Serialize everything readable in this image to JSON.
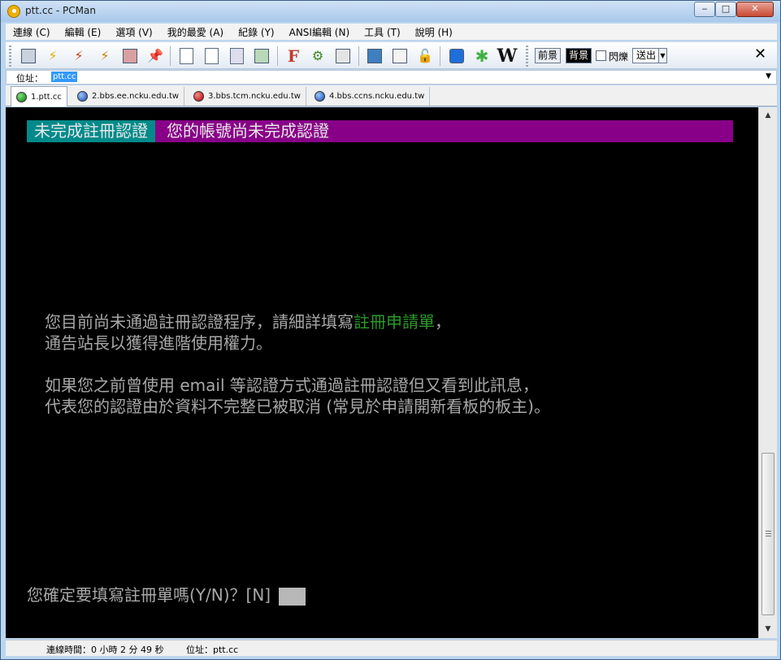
{
  "window": {
    "title": "ptt.cc - PCMan"
  },
  "menu": [
    "連線 (C)",
    "編輯 (E)",
    "選項 (V)",
    "我的最愛 (A)",
    "紀錄 (Y)",
    "ANSI編輯 (N)",
    "工具 (T)",
    "說明 (H)"
  ],
  "toolbar": {
    "fg_label": "前景",
    "bg_label": "背景",
    "blink_label": "閃爍",
    "send_label": "送出"
  },
  "address": {
    "label": "位址：",
    "value": "ptt.cc"
  },
  "tabs": [
    {
      "label": "1.ptt.cc",
      "color": "#0a7a0a"
    },
    {
      "label": "2.bbs.ee.ncku.edu.tw",
      "color": "#1547a8"
    },
    {
      "label": "3.bbs.tcm.ncku.edu.tw",
      "color": "#a40000"
    },
    {
      "label": "4.bbs.ccns.ncku.edu.tw",
      "color": "#1547a8"
    }
  ],
  "terminal": {
    "banner_left": "未完成註冊認證",
    "banner_right": "您的帳號尚未完成認證",
    "line1_a": "您目前尚未通過註冊認證程序，請細詳填寫",
    "line1_green": "註冊申請單",
    "line1_b": "，",
    "line2": "通告站長以獲得進階使用權力。",
    "line3": "如果您之前曾使用 email 等認證方式通過註冊認證但又看到此訊息，",
    "line4": "代表您的認證由於資料不完整已被取消 (常見於申請開新看板的板主)。",
    "prompt": "您確定要填寫註冊單嗎(Y/N)？[N] "
  },
  "status": {
    "connection": "連線時間：0 小時 2 分 49 秒",
    "address": "位址：ptt.cc"
  }
}
